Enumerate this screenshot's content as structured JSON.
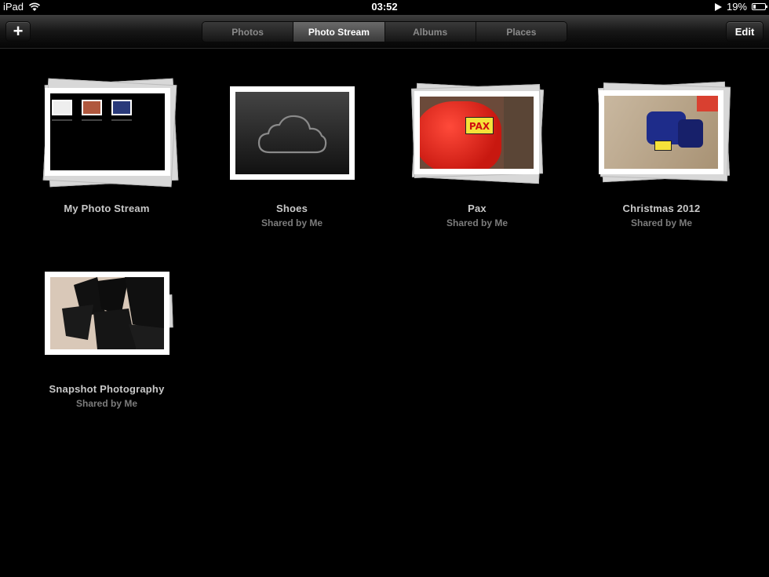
{
  "status_bar": {
    "device": "iPad",
    "time": "03:52",
    "battery": "19%",
    "battery_level": 0.19
  },
  "toolbar": {
    "add_label": "+",
    "edit_label": "Edit",
    "tabs": [
      {
        "label": "Photos",
        "active": false
      },
      {
        "label": "Photo Stream",
        "active": true
      },
      {
        "label": "Albums",
        "active": false
      },
      {
        "label": "Places",
        "active": false
      }
    ]
  },
  "streams": [
    {
      "title": "My Photo Stream",
      "subtitle": ""
    },
    {
      "title": "Shoes",
      "subtitle": "Shared by Me"
    },
    {
      "title": "Pax",
      "subtitle": "Shared by Me"
    },
    {
      "title": "Christmas 2012",
      "subtitle": "Shared by Me"
    },
    {
      "title": "Snapshot Photography",
      "subtitle": "Shared by Me"
    }
  ],
  "colors": {
    "background": "#000000",
    "title_text": "#c9c9c9",
    "subtitle_text": "#7c7c7c",
    "active_segment": "#5a5a5a"
  }
}
